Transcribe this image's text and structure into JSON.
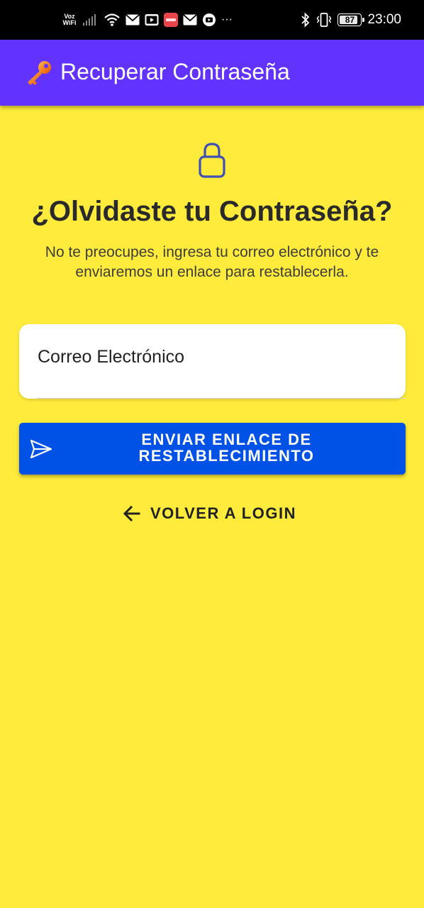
{
  "status_bar": {
    "network_label": "Voz\nWiFi",
    "overflow": "···",
    "battery": "87",
    "time": "23:00"
  },
  "app_bar": {
    "title": "Recuperar Contraseña",
    "icon": "key-icon"
  },
  "main": {
    "icon": "lock-icon",
    "heading": "¿Olvidaste tu Contraseña?",
    "description": "No te preocupes, ingresa tu correo electrónico y te enviaremos un enlace para restablecerla.",
    "email_label": "Correo Electrónico",
    "send_button": "ENVIAR ENLACE DE RESTABLECIMIENTO",
    "back_button": "VOLVER A LOGIN"
  },
  "colors": {
    "background": "#ffeb3b",
    "app_bar": "#6233ff",
    "primary_button": "#0052e6"
  }
}
